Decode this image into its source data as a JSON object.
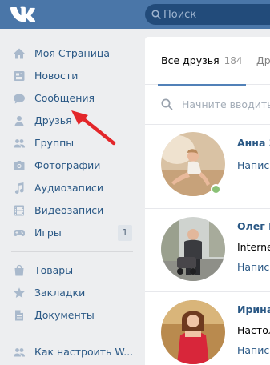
{
  "header": {
    "search_placeholder": "Поиск",
    "accent": "#4a76a8"
  },
  "sidebar": {
    "items": [
      {
        "label": "Моя Страница",
        "icon": "home-icon"
      },
      {
        "label": "Новости",
        "icon": "news-icon"
      },
      {
        "label": "Сообщения",
        "icon": "messages-icon"
      },
      {
        "label": "Друзья",
        "icon": "person-icon"
      },
      {
        "label": "Группы",
        "icon": "groups-icon"
      },
      {
        "label": "Фотографии",
        "icon": "camera-icon"
      },
      {
        "label": "Аудиозаписи",
        "icon": "music-note-icon"
      },
      {
        "label": "Видеозаписи",
        "icon": "film-icon"
      },
      {
        "label": "Игры",
        "icon": "gamepad-icon",
        "badge": "1"
      },
      {
        "label": "Товары",
        "icon": "shopping-bag-icon"
      },
      {
        "label": "Закладки",
        "icon": "star-icon"
      },
      {
        "label": "Документы",
        "icon": "document-icon"
      },
      {
        "label": "Как настроить W...",
        "icon": "community-icon"
      }
    ]
  },
  "friends": {
    "tabs": {
      "all_label": "Все друзья",
      "all_count": "184",
      "other_label": "Др"
    },
    "search_placeholder": "Начните вводить",
    "list": [
      {
        "name": "Анна З",
        "info": "Написа",
        "online": true
      },
      {
        "name": "Олег К",
        "info": "Internet",
        "action": "Написа",
        "online": false
      },
      {
        "name": "Ирина",
        "info": "Настол",
        "action": "Написа",
        "online": false
      }
    ]
  }
}
